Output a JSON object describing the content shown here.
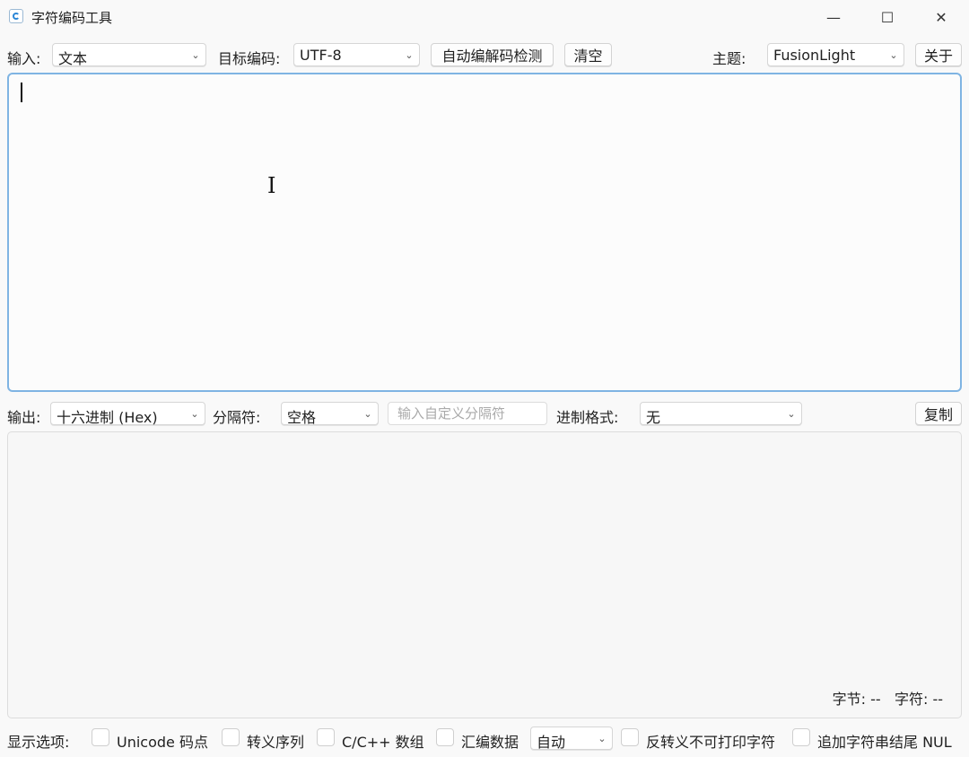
{
  "window": {
    "title": "字符编码工具",
    "minimize_glyph": "—",
    "maximize_glyph": "☐",
    "close_glyph": "✕"
  },
  "toolbar": {
    "input_label": "输入:",
    "input_mode": "文本",
    "target_label": "目标编码:",
    "target_encoding": "UTF-8",
    "auto_detect_button": "自动编解码检测",
    "clear_button": "清空",
    "theme_label": "主题:",
    "theme_value": "FusionLight",
    "about_button": "关于"
  },
  "output_bar": {
    "output_label": "输出:",
    "output_mode": "十六进制 (Hex)",
    "separator_label": "分隔符:",
    "separator_value": "空格",
    "custom_separator_placeholder": "输入自定义分隔符",
    "radix_format_label": "进制格式:",
    "radix_format_value": "无",
    "copy_button": "复制"
  },
  "stats": {
    "bytes_label": "字节:",
    "bytes_value": "--",
    "chars_label": "字符:",
    "chars_value": "--"
  },
  "options": {
    "label": "显示选项:",
    "unicode_codepoint": "Unicode 码点",
    "escape_sequence": "转义序列",
    "c_array": "C/C++ 数组",
    "asm_data": "汇编数据",
    "asm_mode": "自动",
    "unescape_nonprintable": "反转义不可打印字符",
    "append_nul": "追加字符串结尾 NUL"
  },
  "icons": {
    "dropdown": "⌄"
  }
}
